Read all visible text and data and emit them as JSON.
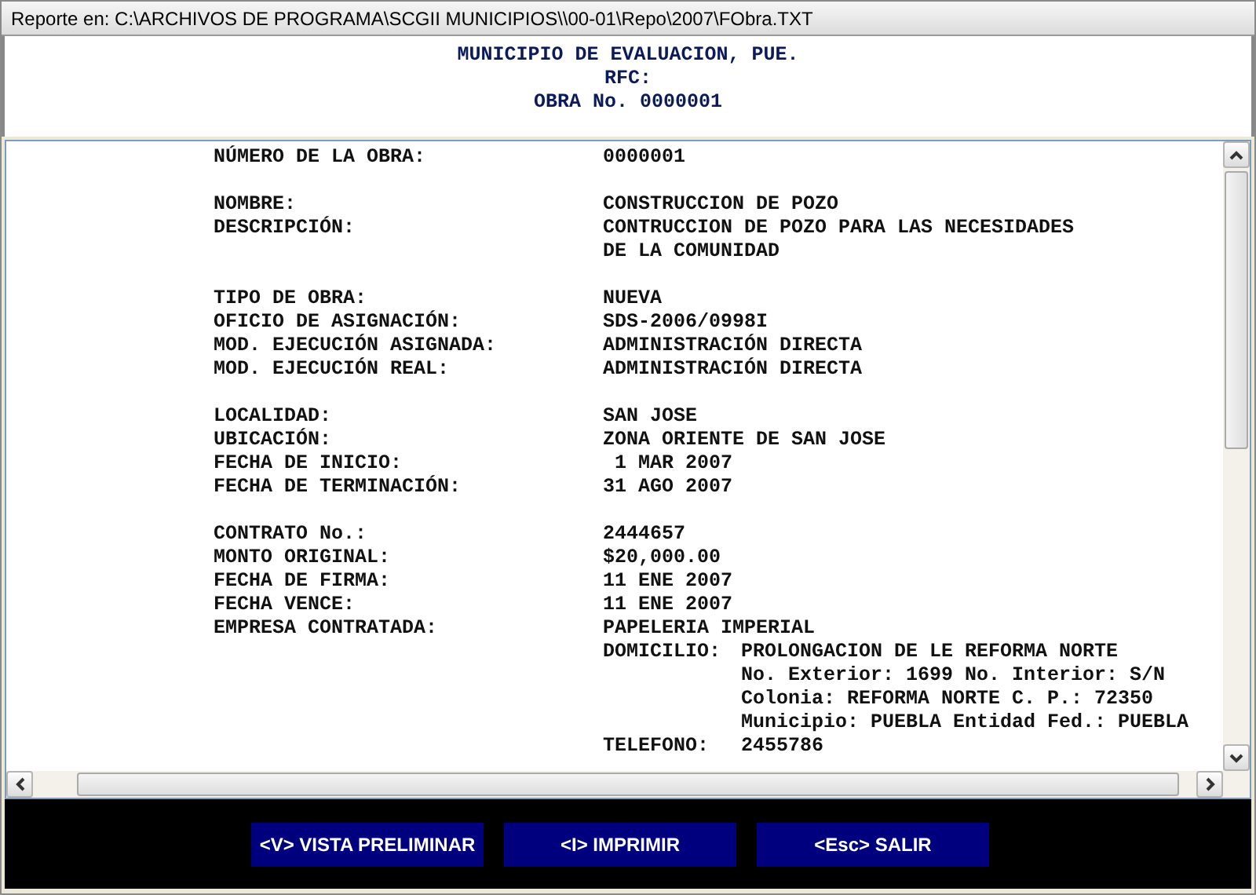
{
  "window": {
    "title": "Reporte en: C:\\ARCHIVOS DE PROGRAMA\\SCGII MUNICIPIOS\\\\00-01\\Repo\\2007\\FObra.TXT"
  },
  "header": [
    "MUNICIPIO DE EVALUACION, PUE.",
    "RFC:",
    "OBRA No. 0000001"
  ],
  "groups": [
    {
      "fields": [
        {
          "label": "NÚMERO DE LA OBRA:",
          "value": [
            "0000001"
          ]
        }
      ]
    },
    {
      "fields": [
        {
          "label": "NOMBRE:",
          "value": [
            "CONSTRUCCION DE POZO"
          ]
        },
        {
          "label": "DESCRIPCIÓN:",
          "value": [
            "CONTRUCCION DE POZO PARA LAS NECESIDADES",
            "DE LA COMUNIDAD"
          ]
        }
      ]
    },
    {
      "fields": [
        {
          "label": "TIPO DE OBRA:",
          "value": [
            "NUEVA"
          ]
        },
        {
          "label": "OFICIO DE ASIGNACIÓN:",
          "value": [
            "SDS-2006/0998I"
          ]
        },
        {
          "label": "MOD. EJECUCIÓN ASIGNADA:",
          "value": [
            "ADMINISTRACIÓN DIRECTA"
          ]
        },
        {
          "label": "MOD. EJECUCIÓN REAL:",
          "value": [
            "ADMINISTRACIÓN DIRECTA"
          ]
        }
      ]
    },
    {
      "fields": [
        {
          "label": "LOCALIDAD:",
          "value": [
            "SAN JOSE"
          ]
        },
        {
          "label": "UBICACIÓN:",
          "value": [
            "ZONA ORIENTE DE SAN JOSE"
          ]
        },
        {
          "label": "FECHA DE INICIO:",
          "value": [
            " 1 MAR 2007"
          ]
        },
        {
          "label": "FECHA DE TERMINACIÓN:",
          "value": [
            "31 AGO 2007"
          ]
        }
      ]
    },
    {
      "fields": [
        {
          "label": "CONTRATO No.:",
          "value": [
            "2444657"
          ]
        },
        {
          "label": "MONTO ORIGINAL:",
          "value": [
            "$20,000.00"
          ]
        },
        {
          "label": "FECHA DE FIRMA:",
          "value": [
            "11 ENE 2007"
          ]
        },
        {
          "label": "FECHA VENCE:",
          "value": [
            "11 ENE 2007"
          ]
        },
        {
          "label": "EMPRESA CONTRATADA:",
          "value": [
            "PAPELERIA IMPERIAL"
          ],
          "sub_fields": [
            {
              "label": "DOMICILIO:",
              "value": [
                "PROLONGACION DE LE REFORMA NORTE",
                "No. Exterior: 1699 No. Interior: S/N",
                "Colonia: REFORMA NORTE C. P.: 72350",
                "Municipio: PUEBLA Entidad Fed.: PUEBLA"
              ]
            },
            {
              "label": "TELEFONO:",
              "value": [
                "2455786"
              ]
            }
          ]
        }
      ]
    }
  ],
  "buttons": [
    "<V> VISTA PRELIMINAR",
    "<I> IMPRIMIR",
    "<Esc> SALIR"
  ]
}
